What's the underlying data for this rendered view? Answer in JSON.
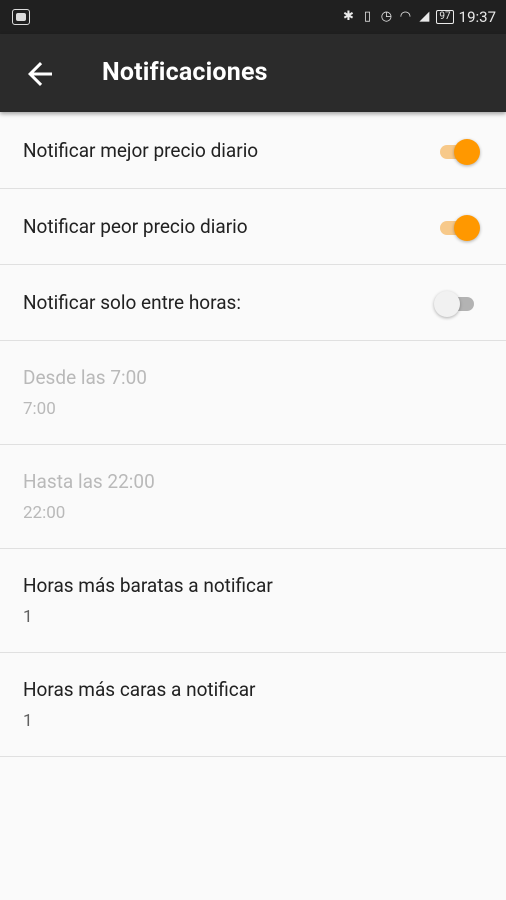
{
  "status_bar": {
    "time": "19:37",
    "battery": "97",
    "icons": [
      "bluetooth-icon",
      "vibrate-icon",
      "alarm-icon",
      "wifi-icon",
      "signal-icon",
      "battery-icon"
    ]
  },
  "app_bar": {
    "title": "Notificaciones",
    "back_icon": "arrow-left-icon"
  },
  "settings": {
    "best_price": {
      "label": "Notificar mejor precio diario",
      "enabled": true
    },
    "worst_price": {
      "label": "Notificar peor precio diario",
      "enabled": true
    },
    "hours_only": {
      "label": "Notificar solo entre horas:",
      "enabled": false
    },
    "from": {
      "label": "Desde las 7:00",
      "summary": "7:00"
    },
    "to": {
      "label": "Hasta las 22:00",
      "summary": "22:00"
    },
    "cheapest": {
      "label": "Horas más baratas a notificar",
      "summary": "1"
    },
    "expensive": {
      "label": "Horas más caras a notificar",
      "summary": "1"
    }
  },
  "colors": {
    "accent": "#ff9800",
    "app_bar": "#2b2b2b",
    "status_bar": "#202020",
    "background": "#fafafa"
  }
}
